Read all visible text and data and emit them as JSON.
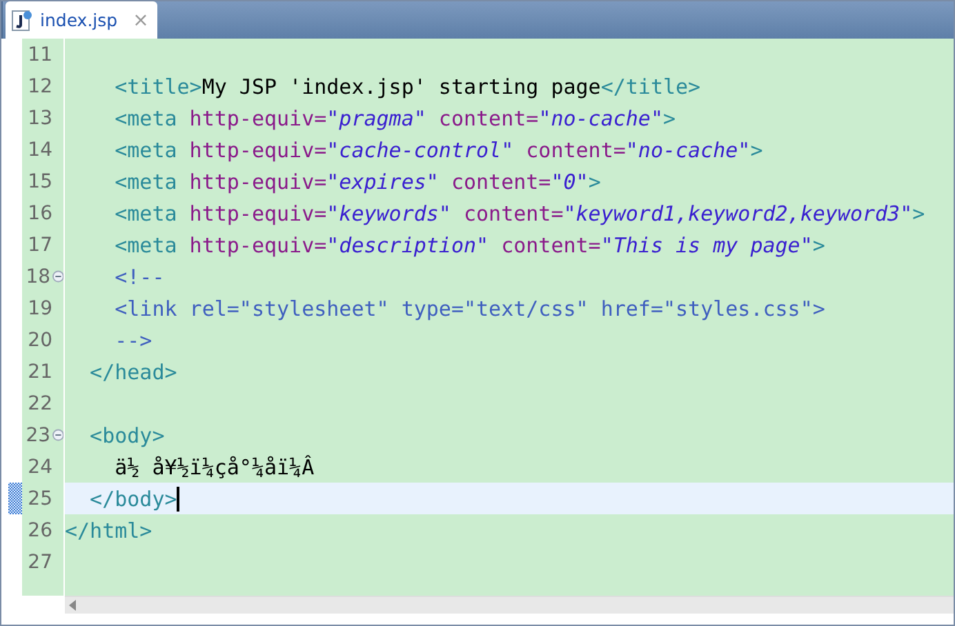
{
  "tabs": [
    {
      "label": "index.jsp",
      "close": "×",
      "selected": true
    }
  ],
  "lines": [
    {
      "number": "11"
    },
    {
      "number": "12",
      "tokens": [
        {
          "kind": "tag",
          "text": "    <title>"
        },
        {
          "kind": "text",
          "text": "My JSP 'index.jsp' starting page"
        },
        {
          "kind": "tag",
          "text": "</title>"
        }
      ]
    },
    {
      "number": "13",
      "tokens": [
        {
          "kind": "tag",
          "text": "    <meta"
        },
        {
          "kind": "attr",
          "text": " http-equiv="
        },
        {
          "kind": "value",
          "text": "\"pragma\""
        },
        {
          "kind": "attr",
          "text": " content="
        },
        {
          "kind": "value",
          "text": "\"no-cache\""
        },
        {
          "kind": "tag",
          "text": ">"
        }
      ]
    },
    {
      "number": "14",
      "tokens": [
        {
          "kind": "tag",
          "text": "    <meta"
        },
        {
          "kind": "attr",
          "text": " http-equiv="
        },
        {
          "kind": "value",
          "text": "\"cache-control\""
        },
        {
          "kind": "attr",
          "text": " content="
        },
        {
          "kind": "value",
          "text": "\"no-cache\""
        },
        {
          "kind": "tag",
          "text": ">"
        }
      ]
    },
    {
      "number": "15",
      "tokens": [
        {
          "kind": "tag",
          "text": "    <meta"
        },
        {
          "kind": "attr",
          "text": " http-equiv="
        },
        {
          "kind": "value",
          "text": "\"expires\""
        },
        {
          "kind": "attr",
          "text": " content="
        },
        {
          "kind": "value",
          "text": "\"0\""
        },
        {
          "kind": "tag",
          "text": ">"
        }
      ]
    },
    {
      "number": "16",
      "tokens": [
        {
          "kind": "tag",
          "text": "    <meta"
        },
        {
          "kind": "attr",
          "text": " http-equiv="
        },
        {
          "kind": "value",
          "text": "\"keywords\""
        },
        {
          "kind": "attr",
          "text": " content="
        },
        {
          "kind": "value",
          "text": "\"keyword1,keyword2,keyword3\""
        },
        {
          "kind": "tag",
          "text": ">"
        }
      ]
    },
    {
      "number": "17",
      "tokens": [
        {
          "kind": "tag",
          "text": "    <meta"
        },
        {
          "kind": "attr",
          "text": " http-equiv="
        },
        {
          "kind": "value",
          "text": "\"description\""
        },
        {
          "kind": "attr",
          "text": " content="
        },
        {
          "kind": "value",
          "text": "\"This is my page\""
        },
        {
          "kind": "tag",
          "text": ">"
        }
      ]
    },
    {
      "number": "18",
      "fold": true,
      "tokens": [
        {
          "kind": "comment",
          "text": "    <!--"
        }
      ]
    },
    {
      "number": "19",
      "tokens": [
        {
          "kind": "comment",
          "text": "    <link rel=\"stylesheet\" type=\"text/css\" href=\"styles.css\">"
        }
      ]
    },
    {
      "number": "20",
      "tokens": [
        {
          "kind": "comment",
          "text": "    -->"
        }
      ]
    },
    {
      "number": "21",
      "tokens": [
        {
          "kind": "tag",
          "text": "  </head>"
        }
      ]
    },
    {
      "number": "22"
    },
    {
      "number": "23",
      "fold": true,
      "tokens": [
        {
          "kind": "tag",
          "text": "  <body>"
        }
      ]
    },
    {
      "number": "24",
      "tokens": [
        {
          "kind": "text",
          "text": "    ä½ å¥½ï¼çå°¼åï¼Â"
        }
      ]
    },
    {
      "number": "25",
      "current": true,
      "tokens": [
        {
          "kind": "tag",
          "text": "  </body>"
        }
      ]
    },
    {
      "number": "26",
      "tokens": [
        {
          "kind": "tag",
          "text": "</html>"
        }
      ]
    },
    {
      "number": "27"
    }
  ]
}
